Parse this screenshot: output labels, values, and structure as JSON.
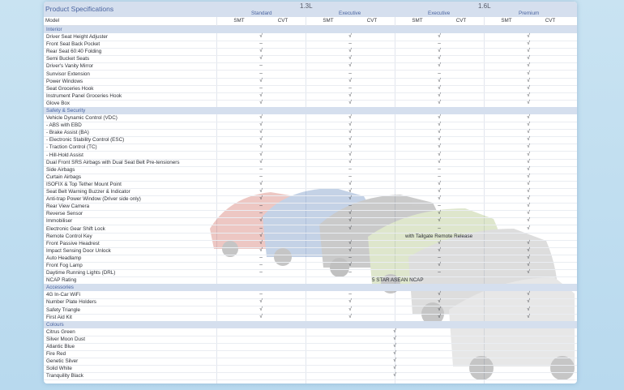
{
  "title": "Product Specifications",
  "engines": [
    "1.3L",
    "1.6L"
  ],
  "grades": [
    "Standard",
    "Executive",
    "Executive",
    "Premium"
  ],
  "model_label": "Model",
  "trans": [
    "SMT",
    "CVT",
    "SMT",
    "CVT",
    "SMT",
    "CVT",
    "SMT",
    "CVT"
  ],
  "tick": "√",
  "dash": "–",
  "sections": [
    {
      "title": "Interior",
      "rows": [
        {
          "label": "Driver Seat Height Adjuster",
          "v": [
            "√",
            "√",
            "√",
            "√"
          ]
        },
        {
          "label": "Front Seat Back Pocket",
          "v": [
            "–",
            "–",
            "–",
            "√"
          ]
        },
        {
          "label": "Rear Seat 60:40 Folding",
          "v": [
            "√",
            "√",
            "√",
            "√"
          ]
        },
        {
          "label": "Semi Bucket Seats",
          "v": [
            "√",
            "√",
            "√",
            "√"
          ]
        },
        {
          "label": "Driver's Vanity Mirror",
          "v": [
            "–",
            "√",
            "√",
            "√"
          ]
        },
        {
          "label": "Sunvisor Extension",
          "v": [
            "–",
            "–",
            "–",
            "√"
          ]
        },
        {
          "label": "Power Windows",
          "v": [
            "√",
            "√",
            "√",
            "√"
          ]
        },
        {
          "label": "Seat Groceries Hook",
          "v": [
            "–",
            "–",
            "√",
            "√"
          ]
        },
        {
          "label": "Instrument Panel Groceries Hook",
          "v": [
            "√",
            "√",
            "√",
            "√"
          ]
        },
        {
          "label": "Glove Box",
          "v": [
            "√",
            "√",
            "√",
            "√"
          ]
        }
      ]
    },
    {
      "title": "Safety & Security",
      "rows": [
        {
          "label": "Vehicle Dynamic Control (VDC)",
          "v": [
            "√",
            "√",
            "√",
            "√"
          ]
        },
        {
          "label": "- ABS with EBD",
          "v": [
            "√",
            "√",
            "√",
            "√"
          ]
        },
        {
          "label": "- Brake Assist (BA)",
          "v": [
            "√",
            "√",
            "√",
            "√"
          ]
        },
        {
          "label": "- Electronic Stability Control (ESC)",
          "v": [
            "√",
            "√",
            "√",
            "√"
          ]
        },
        {
          "label": "- Traction Control (TC)",
          "v": [
            "√",
            "√",
            "√",
            "√"
          ]
        },
        {
          "label": "- Hill-Hold Assist",
          "v": [
            "√",
            "√",
            "√",
            "√"
          ]
        },
        {
          "label": "Dual Front SRS Airbags with Dual Seat Belt Pre-tensioners",
          "v": [
            "√",
            "√",
            "√",
            "√"
          ]
        },
        {
          "label": "Side Airbags",
          "v": [
            "–",
            "–",
            "–",
            "√"
          ]
        },
        {
          "label": "Curtain Airbags",
          "v": [
            "–",
            "–",
            "–",
            "√"
          ]
        },
        {
          "label": "ISOFIX & Top Tether Mount Point",
          "v": [
            "√",
            "√",
            "√",
            "√"
          ]
        },
        {
          "label": "Seat Belt Warning Buzzer & Indicator",
          "v": [
            "√",
            "√",
            "√",
            "√"
          ]
        },
        {
          "label": "Anti-trap Power Window (Driver side only)",
          "v": [
            "√",
            "√",
            "√",
            "√"
          ]
        },
        {
          "label": "Rear View Camera",
          "v": [
            "–",
            "–",
            "–",
            "√"
          ]
        },
        {
          "label": "Reverse Sensor",
          "v": [
            "–",
            "√",
            "√",
            "√"
          ]
        },
        {
          "label": "Immobiliser",
          "v": [
            "√",
            "√",
            "√",
            "√"
          ]
        },
        {
          "label": "Electronic Gear Shift Lock",
          "v": [
            "–",
            "√",
            "–",
            "√"
          ]
        },
        {
          "label": "Remote Control Key",
          "v": [
            "√",
            "",
            "",
            ""
          ],
          "note": "with Tailgate Remote Release"
        },
        {
          "label": "Front Passive Headrest",
          "v": [
            "√",
            "√",
            "√",
            "√"
          ]
        },
        {
          "label": "Impact Sensing Door Unlock",
          "v": [
            "√",
            "√",
            "√",
            "√"
          ]
        },
        {
          "label": "Auto Headlamp",
          "v": [
            "–",
            "–",
            "–",
            "√"
          ]
        },
        {
          "label": "Front Fog Lamp",
          "v": [
            "–",
            "√",
            "√",
            "√"
          ]
        },
        {
          "label": "Daytime Running Lights (DRL)",
          "v": [
            "–",
            "–",
            "–",
            "√"
          ]
        },
        {
          "label": "NCAP Rating",
          "v": [
            "",
            "",
            "",
            ""
          ],
          "note": "5 STAR ASEAN NCAP"
        }
      ]
    },
    {
      "title": "Accessories",
      "rows": [
        {
          "label": "4G In-Car WiFi",
          "v": [
            "–",
            "–",
            "√",
            "√"
          ]
        },
        {
          "label": "Number Plate Holders",
          "v": [
            "√",
            "√",
            "√",
            "√"
          ]
        },
        {
          "label": "Safety Triangle",
          "v": [
            "√",
            "√",
            "√",
            "√"
          ]
        },
        {
          "label": "First Aid Kit",
          "v": [
            "√",
            "√",
            "√",
            "√"
          ]
        }
      ]
    },
    {
      "title": "Colours",
      "rows": [
        {
          "label": "Citrus Green",
          "c": "√"
        },
        {
          "label": "Silver Moon Dust",
          "c": "√"
        },
        {
          "label": "Atlantic Blue",
          "c": "√"
        },
        {
          "label": "Fire Red",
          "c": "√"
        },
        {
          "label": "Genetic Silver",
          "c": "√"
        },
        {
          "label": "Solid White",
          "c": "√"
        },
        {
          "label": "Tranquility Black",
          "c": "√"
        }
      ]
    }
  ],
  "colors": {
    "header_bg": "#d5dfee",
    "header_text": "#4a64a0"
  }
}
